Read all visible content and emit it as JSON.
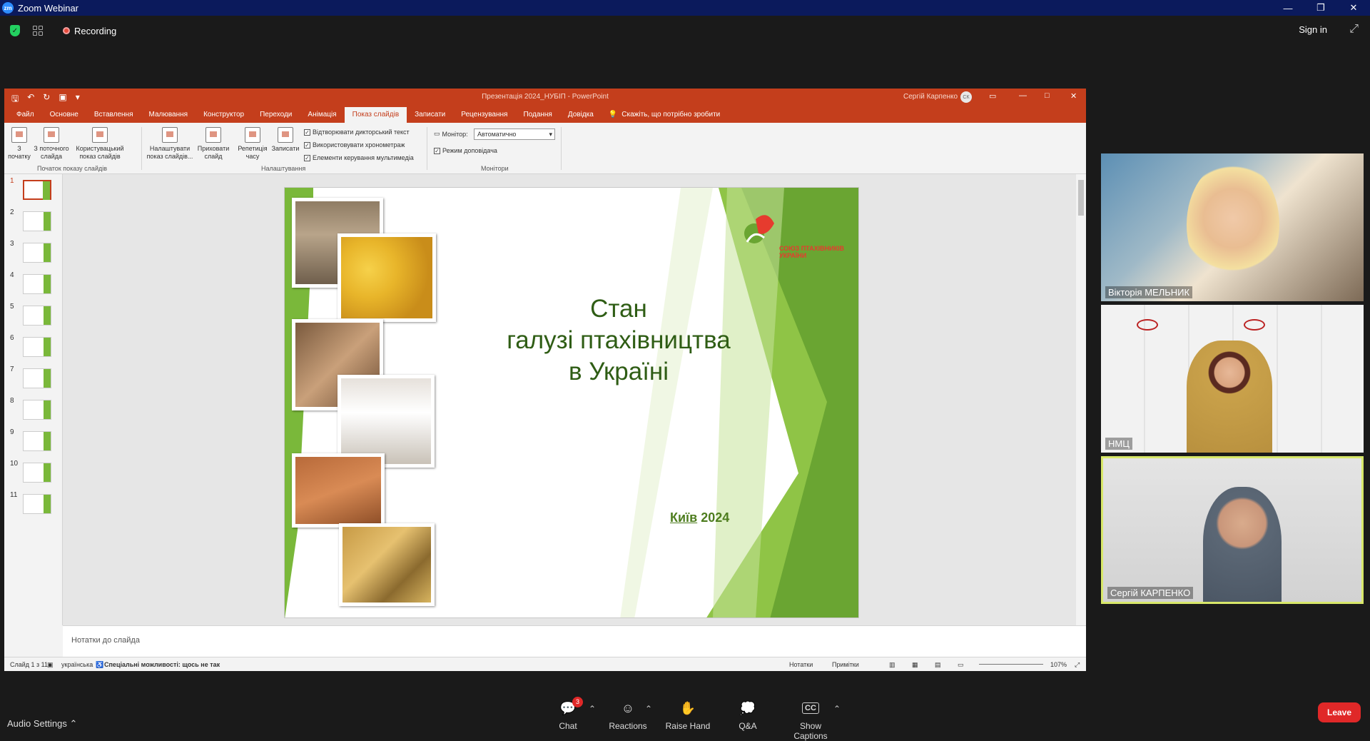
{
  "zoom": {
    "window_title": "Zoom Webinar",
    "recording_label": "Recording",
    "sign_in": "Sign in"
  },
  "ppt": {
    "title": "Презентація 2024_НУБІП  -  PowerPoint",
    "user": "Сергій Карпенко",
    "user_initials": "СК",
    "tabs": [
      "Файл",
      "Основне",
      "Вставлення",
      "Малювання",
      "Конструктор",
      "Переходи",
      "Анімація",
      "Показ слайдів",
      "Записати",
      "Рецензування",
      "Подання",
      "Довідка"
    ],
    "active_tab": "Показ слайдів",
    "tell_me": "Скажіть, що потрібно зробити",
    "ribbon": {
      "from_start": "З початку",
      "from_current": "З поточного слайда",
      "custom_show": "Користувацький показ слайдів",
      "group_start": "Початок показу слайдів",
      "setup_show": "Налаштувати показ слайдів...",
      "hide_slide": "Приховати слайд",
      "rehearse": "Репетиція часу",
      "record": "Записати",
      "check_narration": "Відтворювати дикторський текст",
      "check_timings": "Використовувати хронометраж",
      "check_media": "Елементи керування мультимедіа",
      "group_setup": "Налаштування",
      "monitor_label": "Монітор:",
      "monitor_value": "Автоматично",
      "presenter_view": "Режим доповідача",
      "group_monitors": "Монітори"
    },
    "slide_numbers": [
      "1",
      "2",
      "3",
      "4",
      "5",
      "6",
      "7",
      "8",
      "9",
      "10",
      "11"
    ],
    "notes_placeholder": "Нотатки до слайда",
    "status": {
      "slide_of": "Слайд 1 з 11",
      "language": "українська",
      "accessibility": "Спеціальні можливості: щось не так",
      "notes": "Нотатки",
      "comments": "Примітки",
      "zoom": "107%"
    }
  },
  "slide": {
    "title_lines": [
      "Стан",
      "галузі птахівництва",
      "в Україні"
    ],
    "city": "Київ",
    "year": "2024",
    "logo_text_1": "СОЮЗ ПТАХІВНИКІВ",
    "logo_text_2": "УКРАЇНИ"
  },
  "participants": [
    {
      "name": "Вікторія МЕЛЬНИК"
    },
    {
      "name": "НМЦ"
    },
    {
      "name": "Сергій КАРПЕНКО"
    }
  ],
  "bottom": {
    "audio_settings": "Audio Settings",
    "chat": "Chat",
    "chat_badge": "3",
    "reactions": "Reactions",
    "raise_hand": "Raise Hand",
    "qa": "Q&A",
    "captions": "Show Captions",
    "leave": "Leave"
  },
  "colors": {
    "zoom_titlebar": "#0b1a5c",
    "ppt_accent": "#c43e1c",
    "slide_green": "#7ab83a",
    "title_green": "#2f5d15",
    "leave_red": "#e02828",
    "active_speaker_border": "#d8e86a"
  }
}
